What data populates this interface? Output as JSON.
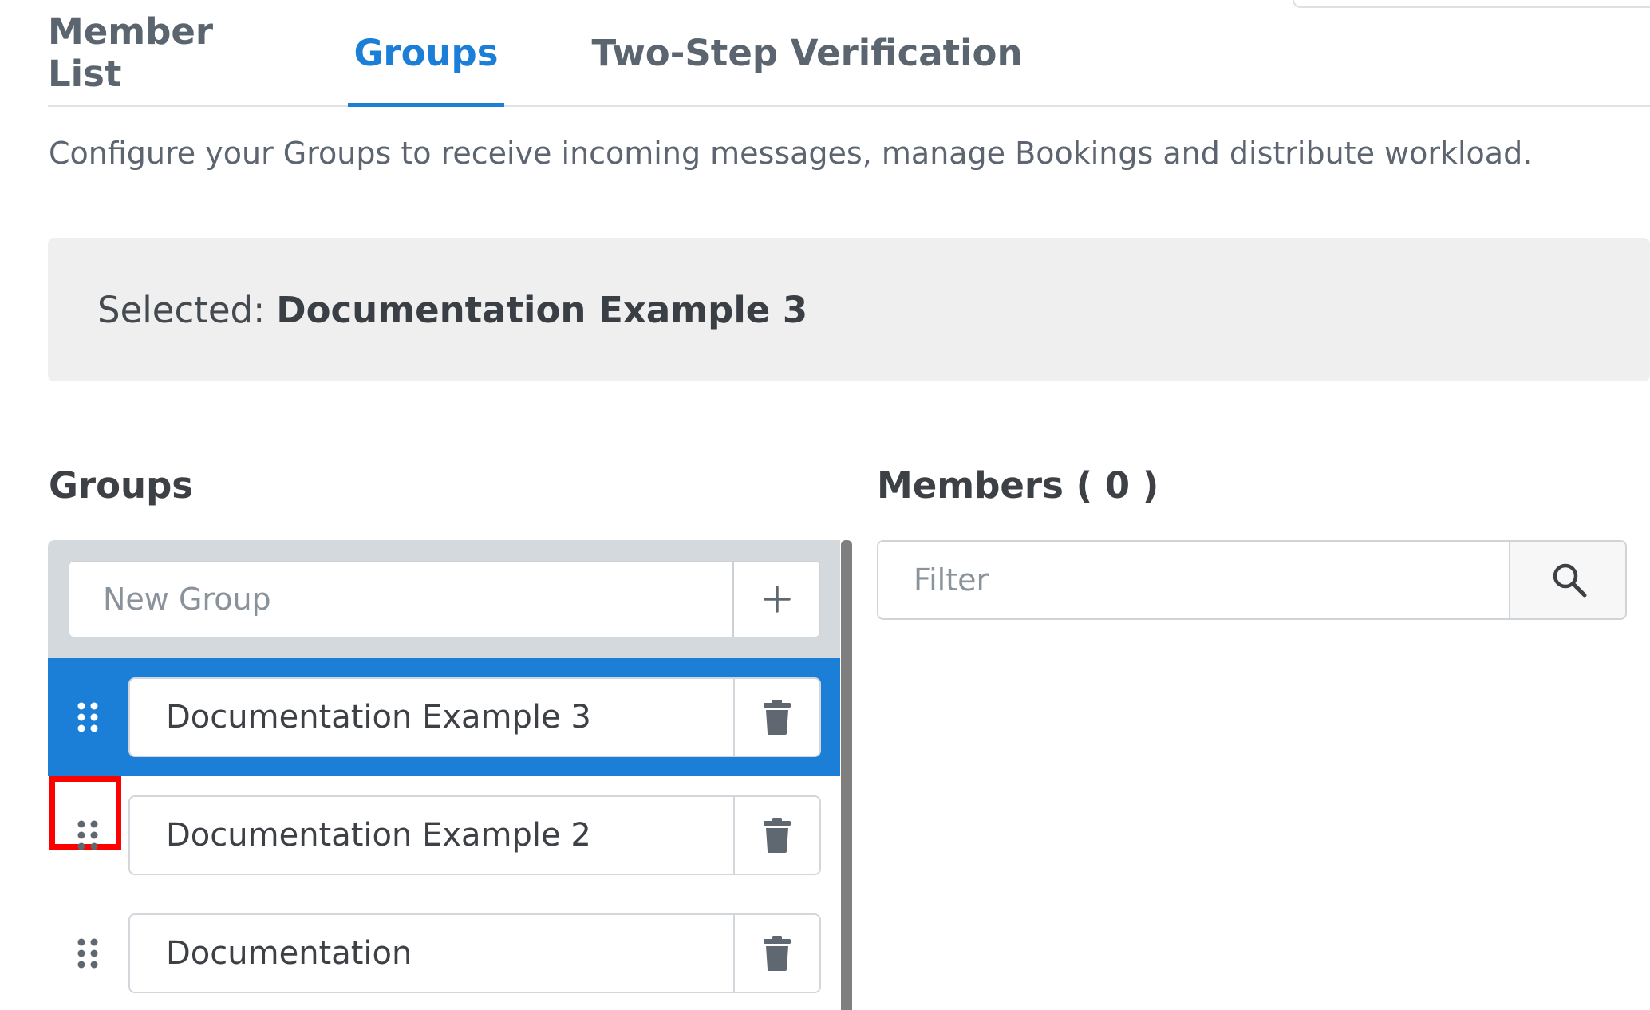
{
  "tabs": [
    {
      "label": "Member List",
      "active": false
    },
    {
      "label": "Groups",
      "active": true
    },
    {
      "label": "Two-Step Verification",
      "active": false
    }
  ],
  "description": "Configure your Groups to receive incoming messages, manage Bookings and distribute workload.",
  "selected": {
    "prefix": "Selected:",
    "name": "Documentation Example 3"
  },
  "groups_panel": {
    "title": "Groups",
    "new_group_placeholder": "New Group",
    "items": [
      {
        "name": "Documentation Example 3",
        "selected": true
      },
      {
        "name": "Documentation Example 2",
        "selected": false,
        "highlighted": true
      },
      {
        "name": "Documentation",
        "selected": false
      }
    ]
  },
  "members_panel": {
    "title": "Members ( 0 )",
    "filter_placeholder": "Filter"
  },
  "colors": {
    "accent": "#1b7fd8",
    "highlight": "#ff0000",
    "icon": "#5f6870"
  },
  "icons": {
    "add": "plus-icon",
    "delete": "trash-icon",
    "drag": "drag-handle-icon",
    "search": "search-icon"
  }
}
